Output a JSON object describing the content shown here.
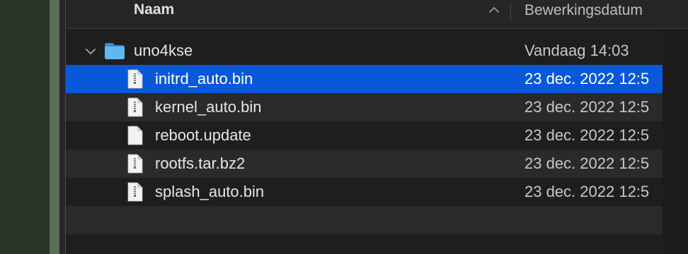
{
  "columns": {
    "name": "Naam",
    "date": "Bewerkingsdatum"
  },
  "folder": {
    "name": "uno4kse",
    "date": "Vandaag 14:03",
    "icon": "folder-icon",
    "color": "#3ea5e8",
    "expanded": true
  },
  "files": [
    {
      "name": "initrd_auto.bin",
      "date": "23 dec. 2022 12:5",
      "selected": true
    },
    {
      "name": "kernel_auto.bin",
      "date": "23 dec. 2022 12:5",
      "selected": false
    },
    {
      "name": "reboot.update",
      "date": "23 dec. 2022 12:5",
      "selected": false
    },
    {
      "name": "rootfs.tar.bz2",
      "date": "23 dec. 2022 12:5",
      "selected": false
    },
    {
      "name": "splash_auto.bin",
      "date": "23 dec. 2022 12:5",
      "selected": false
    }
  ],
  "selection_color": "#0958d9"
}
